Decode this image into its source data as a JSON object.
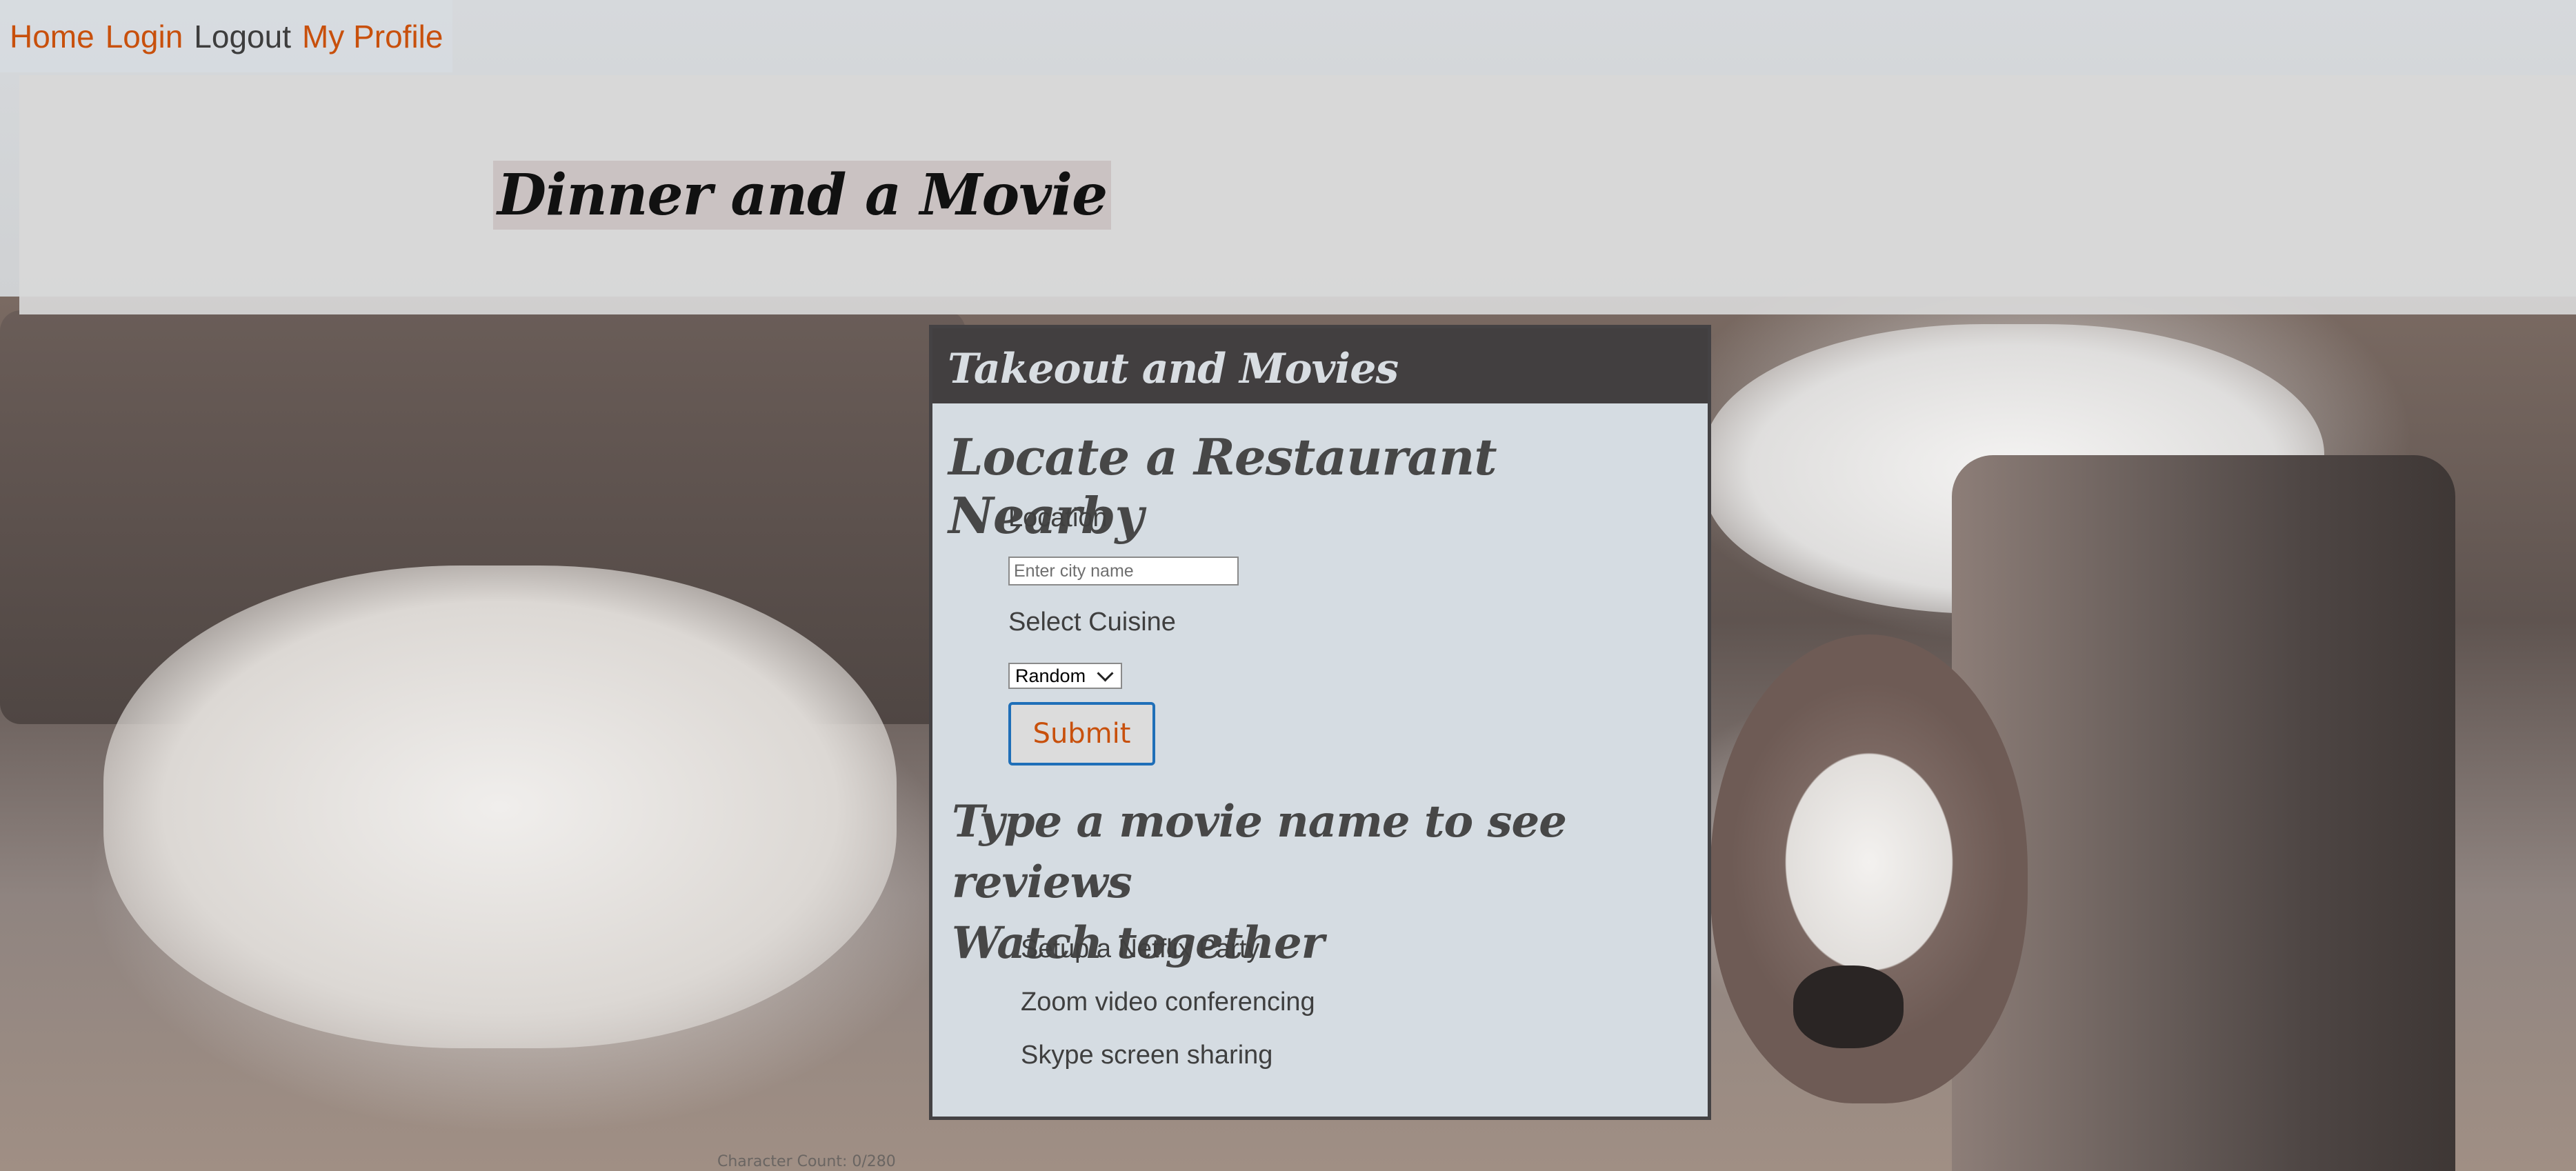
{
  "nav": {
    "home": "Home",
    "login": "Login",
    "logout": "Logout",
    "profile": "My Profile"
  },
  "header": {
    "title": "Dinner and a Movie"
  },
  "card": {
    "header": "Takeout and Movies",
    "restaurant": {
      "title": "Locate a Restaurant Nearby",
      "location_label": "Location",
      "city_placeholder": "Enter city name",
      "cuisine_label": "Select Cuisine",
      "cuisine_selected": "Random",
      "submit_label": "Submit"
    },
    "movie": {
      "title_line1": "Type a movie name to see reviews",
      "title_line2": "Watch together",
      "items": [
        "Setup a Netflix Party",
        "Zoom video conferencing",
        "Skype screen sharing"
      ]
    }
  },
  "footer": {
    "char_count": "Character Count: 0/280"
  },
  "colors": {
    "accent_orange": "#c8500c",
    "card_header": "#423f40",
    "card_bg": "#d5dce2",
    "submit_border": "#1f6fb8"
  }
}
